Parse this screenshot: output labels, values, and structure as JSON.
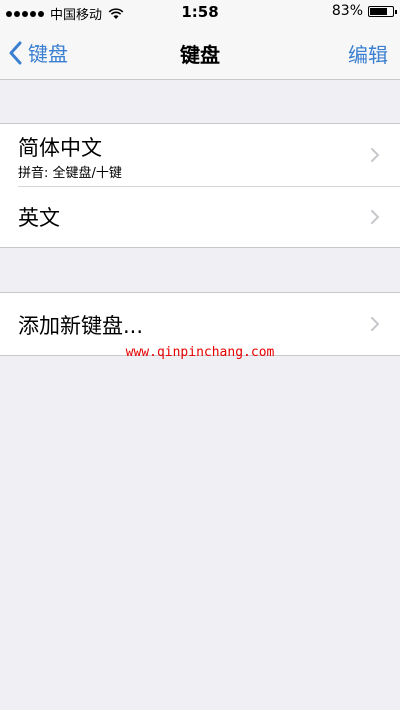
{
  "status_bar": {
    "carrier": "中国移动",
    "time": "1:58",
    "battery_percent": "83%",
    "battery_level": 0.83
  },
  "nav": {
    "back_label": "键盘",
    "title": "键盘",
    "edit_label": "编辑"
  },
  "keyboards": [
    {
      "title": "简体中文",
      "subtitle": "拼音: 全键盘/十键"
    },
    {
      "title": "英文"
    }
  ],
  "add_keyboard": {
    "title": "添加新键盘..."
  },
  "watermark": "www.qinpinchang.com",
  "colors": {
    "accent": "#3a7fd0",
    "background": "#efeff4",
    "watermark": "#e60000"
  }
}
